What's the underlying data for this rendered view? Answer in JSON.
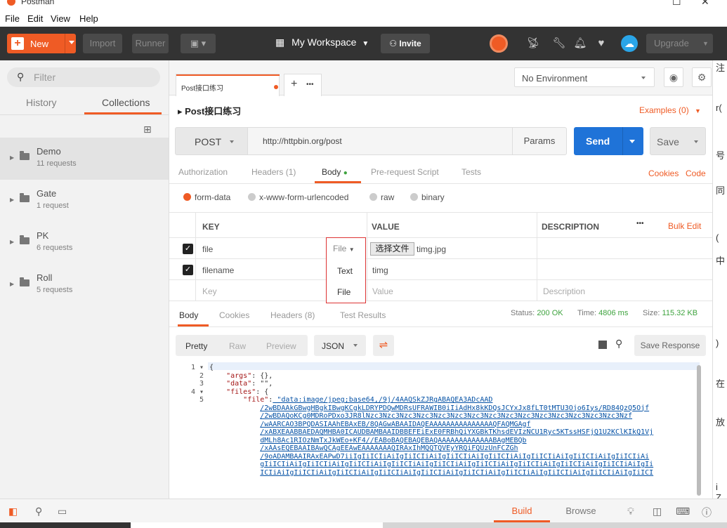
{
  "window": {
    "title": "Postman",
    "controls": [
      "☐",
      "✕"
    ]
  },
  "menu": [
    "File",
    "Edit",
    "View",
    "Help"
  ],
  "header": {
    "new_label": "New",
    "import_label": "Import",
    "runner_label": "Runner",
    "workspace_label": "My Workspace",
    "invite_label": "Invite",
    "upgrade_label": "Upgrade"
  },
  "sidebar": {
    "filter_placeholder": "Filter",
    "tabs": [
      "History",
      "Collections"
    ],
    "collections": [
      {
        "name": "Demo",
        "count": "11 requests"
      },
      {
        "name": "Gate",
        "count": "1 request"
      },
      {
        "name": "PK",
        "count": "6 requests"
      },
      {
        "name": "Roll",
        "count": "5 requests"
      }
    ]
  },
  "tabs": {
    "active_tab": "Post接口练习",
    "more": "•••"
  },
  "environment": {
    "selected": "No Environment"
  },
  "request": {
    "name": "▸ Post接口练习",
    "examples": "Examples (0)",
    "method": "POST",
    "url": "http://httpbin.org/post",
    "params_label": "Params",
    "send_label": "Send",
    "save_label": "Save"
  },
  "request_tabs": {
    "authorization": "Authorization",
    "headers": "Headers (1)",
    "body": "Body",
    "prerequest": "Pre-request Script",
    "tests": "Tests",
    "cookies": "Cookies",
    "code": "Code"
  },
  "body_modes": [
    "form-data",
    "x-www-form-urlencoded",
    "raw",
    "binary"
  ],
  "kv_table": {
    "headers": {
      "key": "KEY",
      "value": "VALUE",
      "description": "DESCRIPTION",
      "more": "•••",
      "bulk_edit": "Bulk Edit"
    },
    "rows": [
      {
        "key": "file",
        "type": "File",
        "file_button": "选择文件",
        "value": "timg.jpg"
      },
      {
        "key": "filename",
        "value": "timg"
      }
    ],
    "placeholders": {
      "key": "Key",
      "value": "Value",
      "description": "Description"
    }
  },
  "type_dropdown": {
    "current": "File",
    "options": [
      "Text",
      "File"
    ]
  },
  "response": {
    "tabs": [
      "Body",
      "Cookies",
      "Headers (8)",
      "Test Results"
    ],
    "status_label": "Status:",
    "status_value": "200 OK",
    "time_label": "Time:",
    "time_value": "4806 ms",
    "size_label": "Size:",
    "size_value": "115.32 KB",
    "view_modes": [
      "Pretty",
      "Raw",
      "Preview"
    ],
    "format": "JSON",
    "save_response": "Save Response"
  },
  "code_lines": [
    {
      "n": "1 ▾",
      "text": "{"
    },
    {
      "n": "2",
      "text": "    \"args\": {},"
    },
    {
      "n": "3",
      "text": "    \"data\": \"\","
    },
    {
      "n": "4 ▾",
      "text": "    \"files\": {"
    },
    {
      "n": "5",
      "text": "        \"file\": \"data:image/jpeg;base64,/9j/4AAQSkZJRgABAQEA3ADcAAD"
    },
    {
      "n": "",
      "text": "            /2wBDAAkGBwgHBgkIBwgKCgkLDRYPDQwMDRsUFRAWIB0iIiAdHx8kKDQsJCYxJx8fLT0tMTU3Ojo6Iys/RD84QzQ5Ojf"
    },
    {
      "n": "",
      "text": "            /2wBDAQoKCg0MDRoPDxo3JR8lNzc3Nzc3Nzc3Nzc3Nzc3Nzc3Nzc3Nzc3Nzc3Nzc3Nzc3Nzc3Nzc3Nzc3Nzc3Nzf"
    },
    {
      "n": "",
      "text": "            /wAARCAO3BPQDASIAAhEBAxEB/8QAGwABAAIDAQEAAAAAAAAAAAAAAAQFAQMGAgf"
    },
    {
      "n": "",
      "text": "            /xABXEAABBAEDAQMHBA0ICAUDBAMBAAIDBBEFEiExE0FRBhQiYXGBkTKhsdEVIzNCU1Ryc5KTssHSFjQ1U2KClKIkQ1Vj"
    },
    {
      "n": "",
      "text": "            dMLh8Ac1RIOzNmTxJkWEo+KF4//EABoBAQEBAQEBAQAAAAAAAAAAAAABAgMEBQb"
    },
    {
      "n": "",
      "text": "            /xAAsEQEBAAIBAwQCAgEEAwEAAAAAAAQIRAxIhMQQTQVEyYRQiFQUzUnFCZGh"
    },
    {
      "n": "",
      "text": "            /9oADAMBAAIRAxEAPwD7iiIgIiICIiAiIgIiICIiAiIgIiICIiAiIgIiICIiAiIgIiICIiAiIgIiICIiAiIgIiICIiAi"
    },
    {
      "n": "",
      "text": "            gIiICIiAiIgIiICIiAiIgIiICIiAiIgIiICIiAiIgIiICIiAiIgIiICIiAiIgIiICIiAiIgIiICIiAiIgIiICIiAiIgIi"
    },
    {
      "n": "",
      "text": "            ICIiAiIgIiICIiAiIgIiICIiAiIgIiICIiAiIgIiICIiAiIgIiICIiAiIgIiICIiAiIgIiICIiAiIgIiICIiAiIgIiICI"
    }
  ],
  "footer": {
    "build": "Build",
    "browse": "Browse"
  },
  "right_edge_glyphs": [
    "注",
    "r(",
    "号",
    "同",
    "(",
    "中",
    ")",
    "在",
    "放",
    "i",
    "Z"
  ]
}
